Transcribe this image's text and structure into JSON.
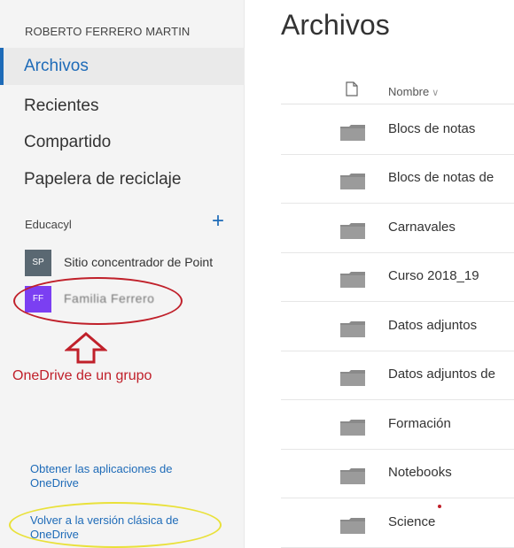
{
  "sidebar": {
    "user_name": "ROBERTO FERRERO MARTIN",
    "nav": [
      {
        "label": "Archivos",
        "active": true
      },
      {
        "label": "Recientes",
        "active": false
      },
      {
        "label": "Compartido",
        "active": false
      },
      {
        "label": "Papelera de reciclaje",
        "active": false
      }
    ],
    "section_label": "Educacyl",
    "add_icon": "plus-icon",
    "sites": [
      {
        "badge": "SP",
        "label": "Sitio concentrador de Point",
        "color": "#5a6872"
      },
      {
        "badge": "FF",
        "label": "Familia Ferrero",
        "color": "#7b3ff2"
      }
    ],
    "annotation_text": "OneDrive de un grupo",
    "footer_links": [
      "Obtener las aplicaciones de OneDrive",
      "Volver a la versión clásica de OneDrive"
    ]
  },
  "main": {
    "title": "Archivos",
    "column_name": "Nombre",
    "sort_icon": "chevron-down-icon",
    "rows": [
      "Blocs de notas",
      "Blocs de notas de",
      "Carnavales",
      "Curso 2018_19",
      "Datos adjuntos",
      "Datos adjuntos de",
      "Formación",
      "Notebooks",
      "Science"
    ]
  },
  "colors": {
    "accent": "#1e6bb8",
    "annotation_red": "#c0202a",
    "annotation_yellow": "#e9e13a",
    "folder": "#8a8a8a"
  }
}
